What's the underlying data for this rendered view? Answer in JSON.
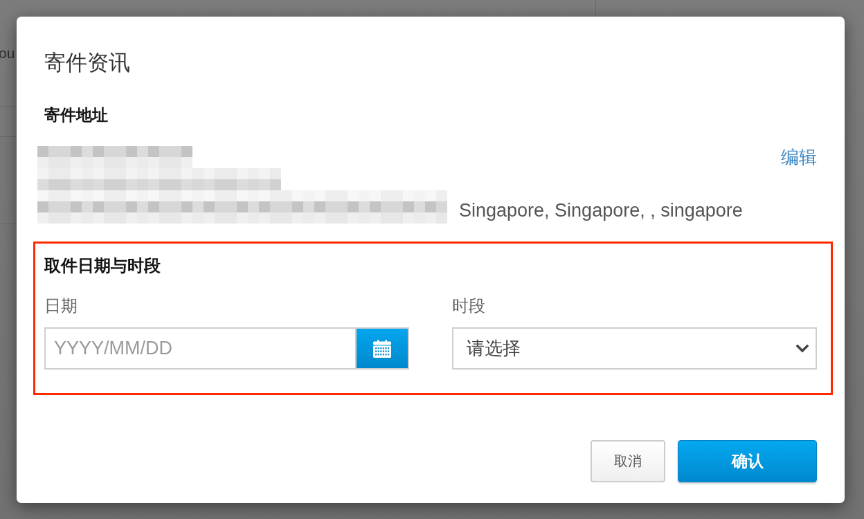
{
  "background": {
    "text_fragment": "ou"
  },
  "dialog": {
    "title": "寄件资讯",
    "sender_address": {
      "heading": "寄件地址",
      "edit_link": "编辑",
      "address_tail": "Singapore, Singapore, , singapore"
    },
    "pickup": {
      "highlighted": true,
      "heading": "取件日期与时段",
      "date": {
        "label": "日期",
        "placeholder": "YYYY/MM/DD"
      },
      "time_slot": {
        "label": "时段",
        "value": "请选择"
      }
    },
    "buttons": [
      {
        "label": "取消",
        "kind": "secondary"
      },
      {
        "label": "确认",
        "kind": "primary"
      }
    ]
  }
}
